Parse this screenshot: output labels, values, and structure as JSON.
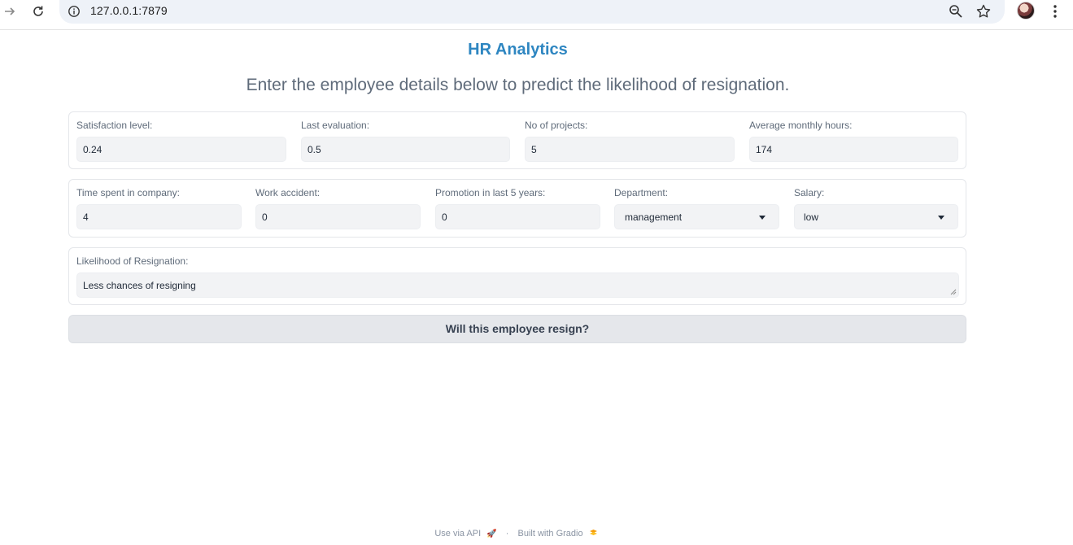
{
  "browser": {
    "url": "127.0.0.1:7879"
  },
  "app": {
    "title": "HR Analytics",
    "subtitle": "Enter the employee details below to predict the likelihood of resignation."
  },
  "row1": [
    {
      "label": "Satisfaction level:",
      "value": "0.24"
    },
    {
      "label": "Last evaluation:",
      "value": "0.5"
    },
    {
      "label": "No of projects:",
      "value": "5"
    },
    {
      "label": "Average monthly hours:",
      "value": "174"
    }
  ],
  "row2": [
    {
      "label": "Time spent in company:",
      "value": "4"
    },
    {
      "label": "Work accident:",
      "value": "0"
    },
    {
      "label": "Promotion in last 5 years:",
      "value": "0"
    },
    {
      "label": "Department:",
      "value": "management"
    },
    {
      "label": "Salary:",
      "value": "low"
    }
  ],
  "output": {
    "label": "Likelihood of Resignation:",
    "value": "Less chances of resigning"
  },
  "submit_label": "Will this employee resign?",
  "footer": {
    "api": "Use via API",
    "separator": "·",
    "built": "Built with Gradio"
  },
  "colors": {
    "title": "#2e86c1",
    "input_bg": "#f2f3f5",
    "button_bg": "#e5e7eb"
  }
}
